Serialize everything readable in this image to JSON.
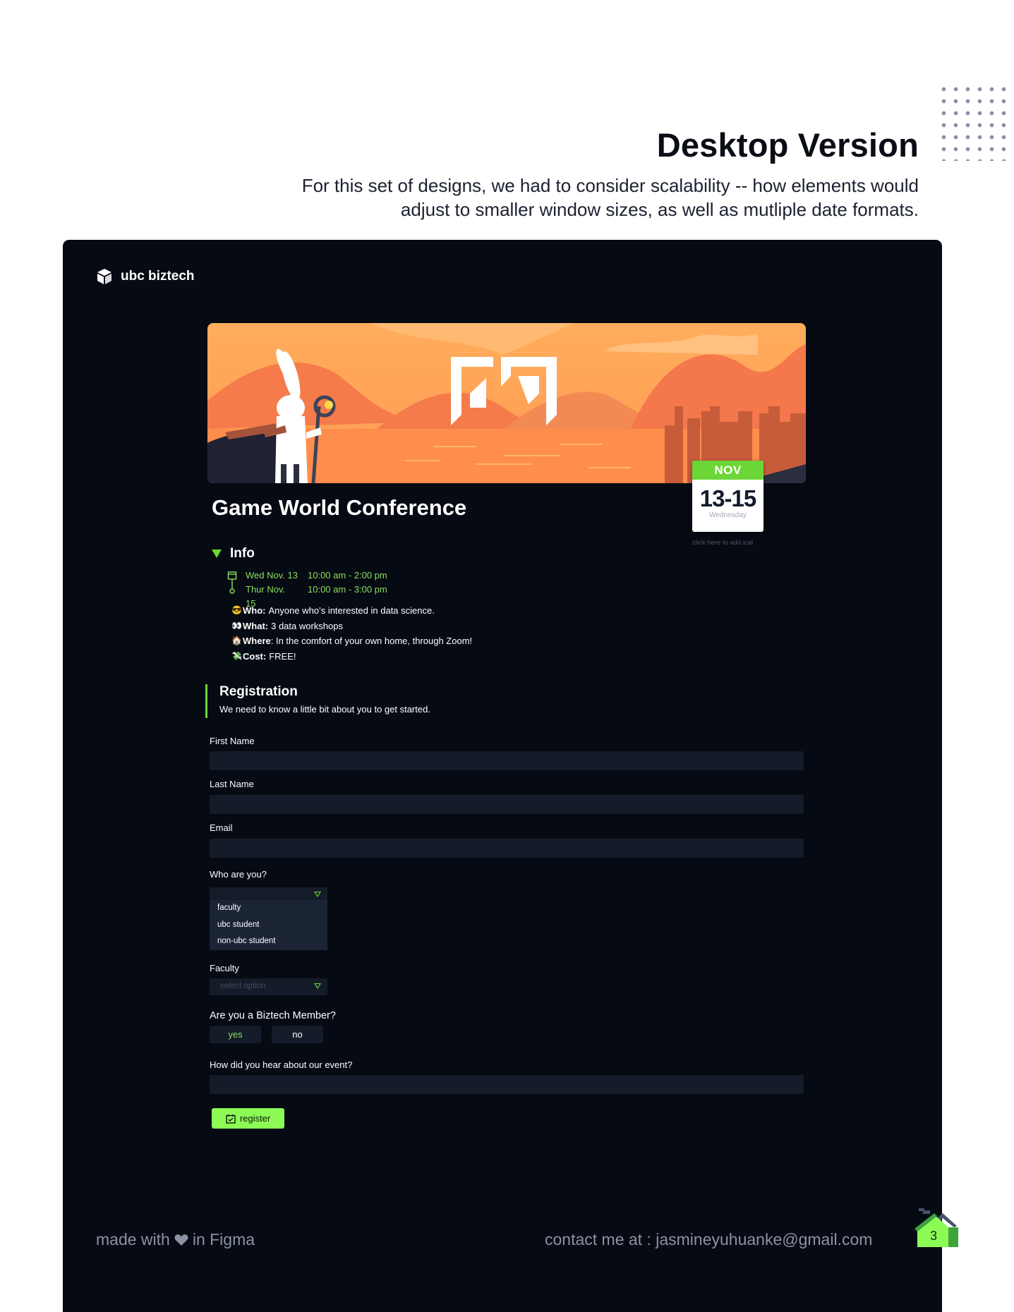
{
  "header": {
    "title": "Desktop Version",
    "description": "For this set of designs, we had to consider scalability -- how elements would adjust to smaller window sizes, as well as mutliple date formats."
  },
  "app": {
    "logo_text": "ubc biztech",
    "banner_alt": "game world conference banner"
  },
  "event": {
    "title": "Game World Conference",
    "date_card": {
      "month": "NOV",
      "days": "13-15",
      "weekday": "Wednesday"
    },
    "ical_link": "click here to add ical"
  },
  "info": {
    "heading": "Info",
    "schedule": [
      {
        "date": "Wed Nov. 13",
        "time": "10:00 am - 2:00 pm"
      },
      {
        "date": "Thur Nov. 15",
        "time": "10:00 am - 3:00 pm"
      }
    ],
    "details": [
      {
        "icon": "😎",
        "label": "Who:",
        "text": "Anyone who’s interested in data science."
      },
      {
        "icon": "👀",
        "label": "What:",
        "text": "3 data workshops"
      },
      {
        "icon": "🏠",
        "label": "Where",
        "text": ": In the comfort of your own home, through Zoom!"
      },
      {
        "icon": "💸",
        "label": "Cost:",
        "text": "FREE!"
      }
    ]
  },
  "registration": {
    "title": "Registration",
    "subtitle": "We need to know a little bit about you to get started.",
    "first_name_label": "First Name",
    "last_name_label": "Last Name",
    "email_label": "Email",
    "who_label": "Who are you?",
    "who_options": [
      "faculty",
      "ubc student",
      "non-ubc student"
    ],
    "faculty_label": "Faculty",
    "faculty_placeholder": "select option",
    "member_label": "Are you a Biztech Member?",
    "member_yes": "yes",
    "member_no": "no",
    "hear_label": "How did you hear about our event?",
    "register_label": "register"
  },
  "footer": {
    "made_with_prefix": "made with",
    "made_with_suffix": "in Figma",
    "contact": "contact me at : jasmineyuhuanke@gmail.com",
    "page_number": "3"
  },
  "colors": {
    "accent": "#6bd636",
    "button_green": "#8dfb55",
    "background": "#060a13",
    "field": "#141b29"
  }
}
